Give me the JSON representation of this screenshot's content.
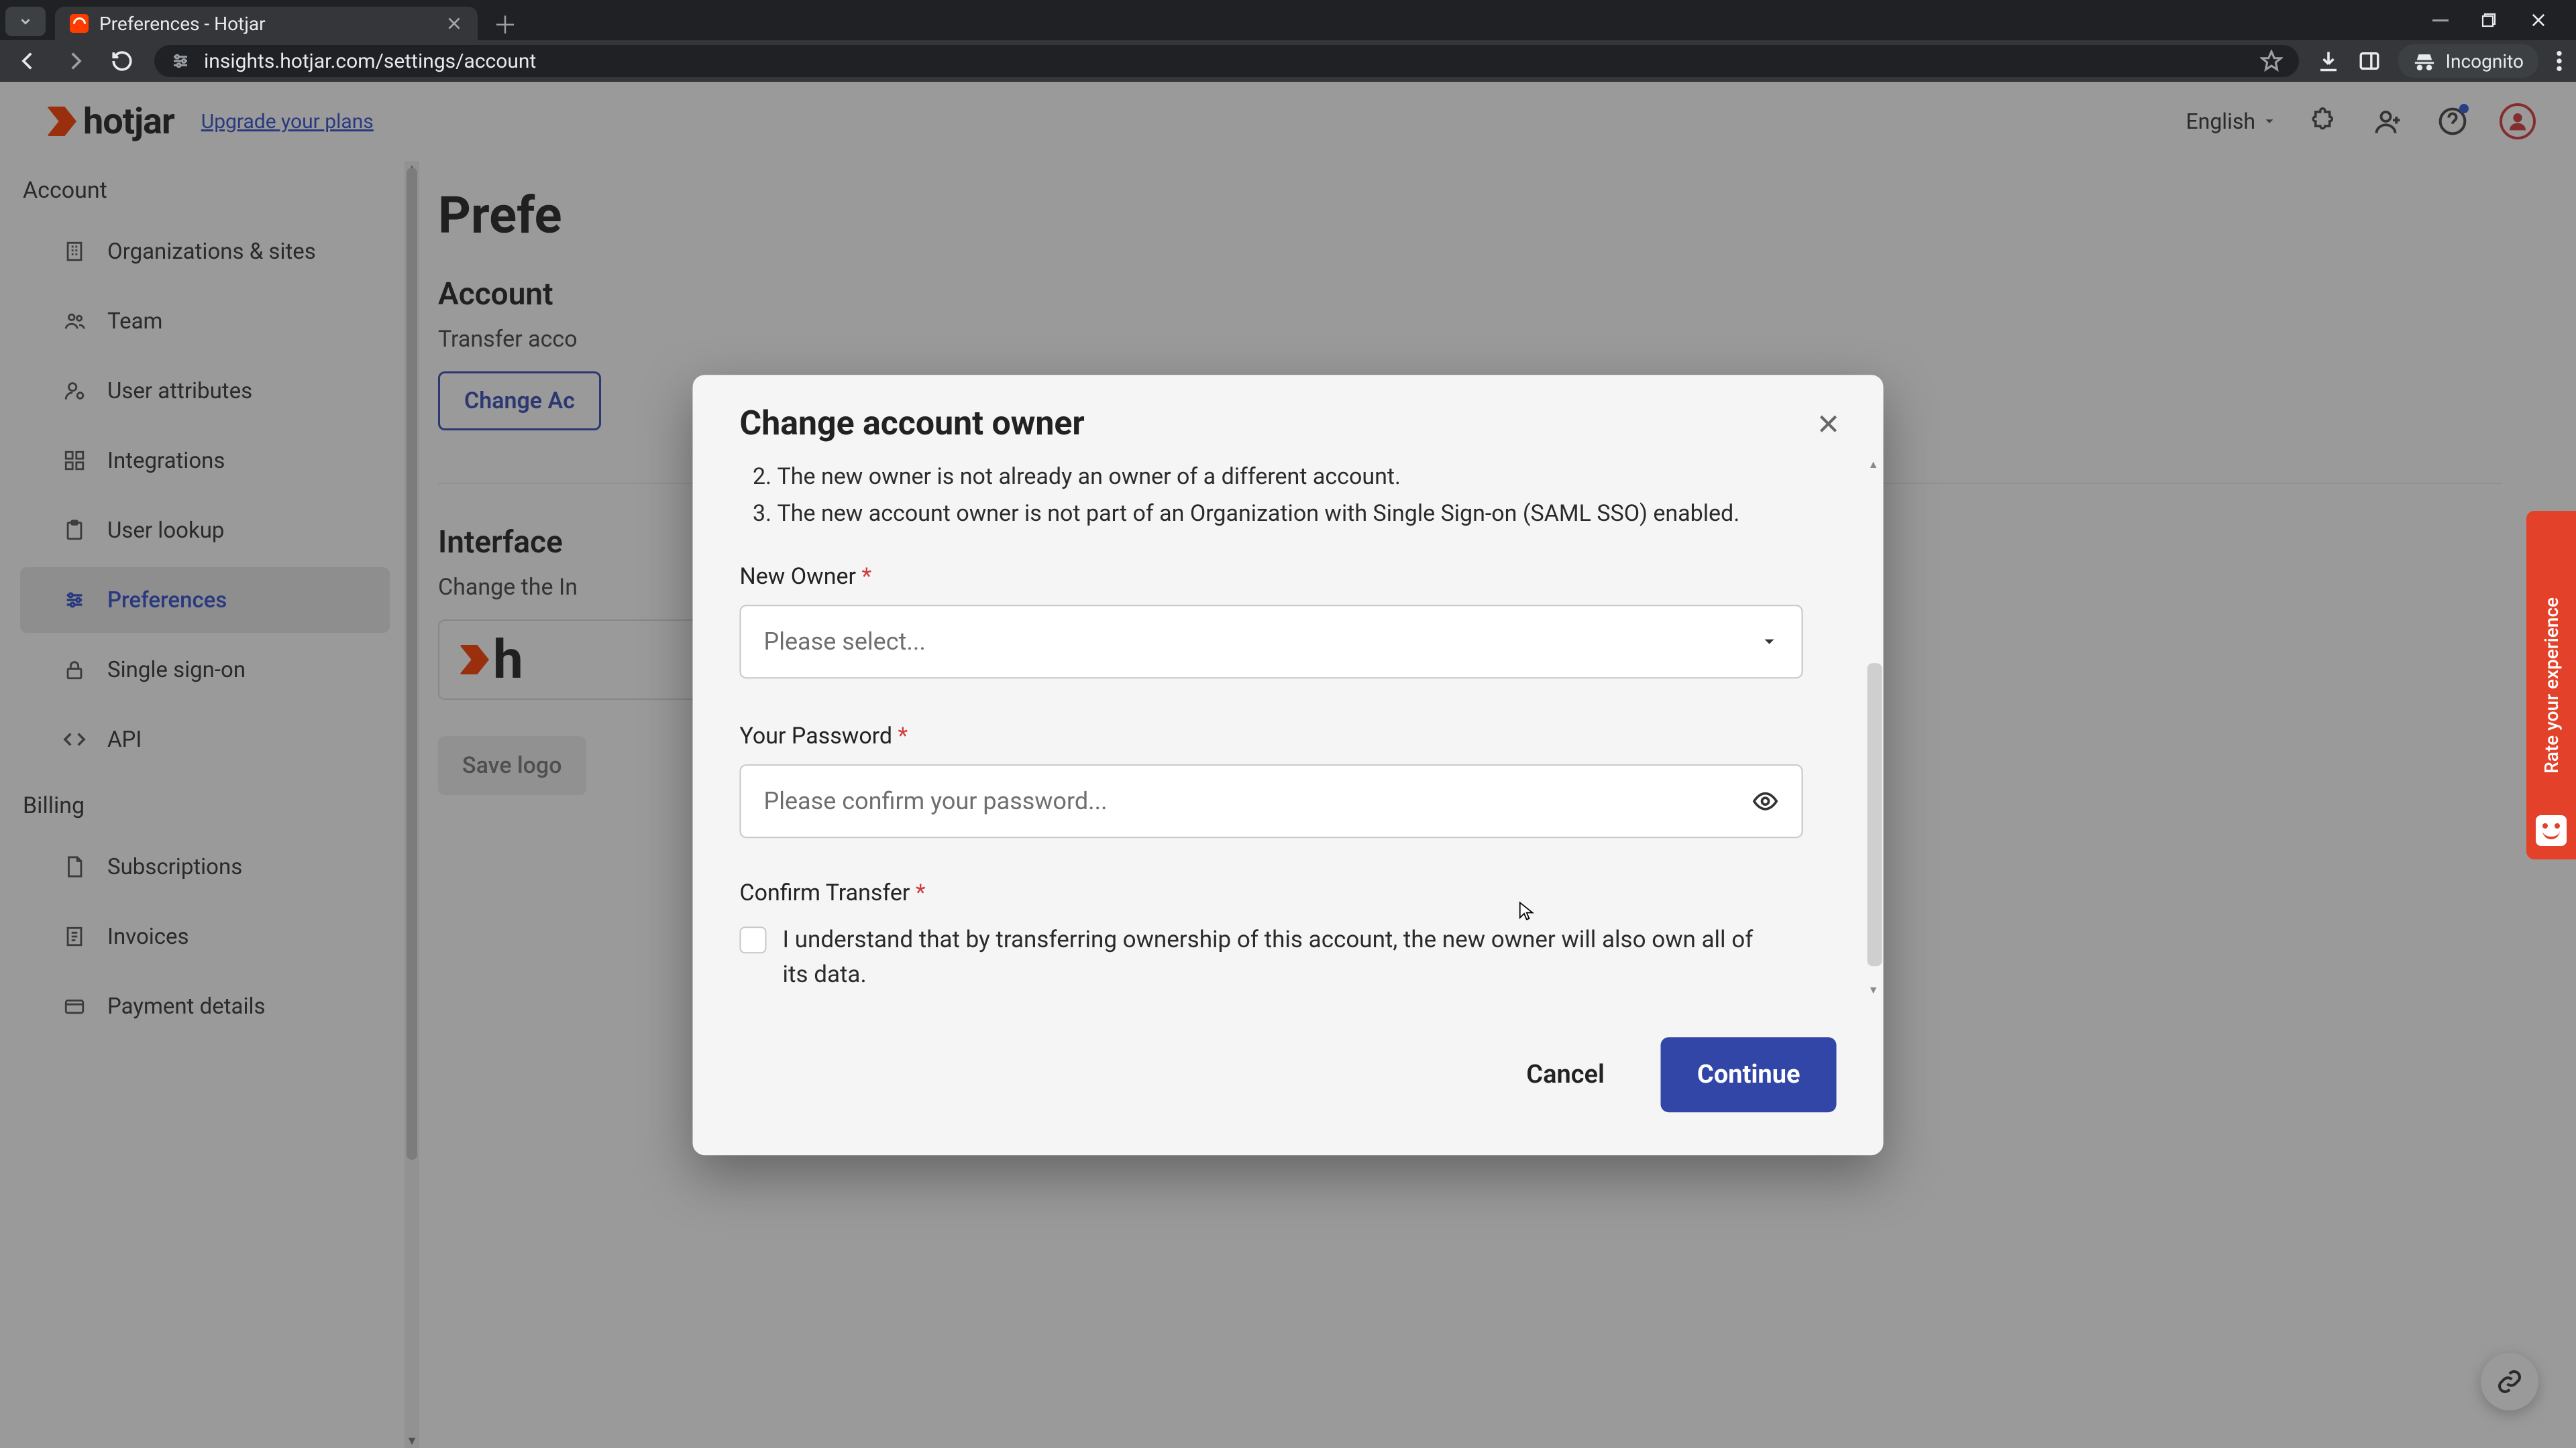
{
  "browser": {
    "tab_title": "Preferences - Hotjar",
    "url": "insights.hotjar.com/settings/account",
    "incognito_label": "Incognito"
  },
  "appbar": {
    "brand": "hotjar",
    "upgrade": "Upgrade your plans",
    "language": "English"
  },
  "sidebar": {
    "section_account": "Account",
    "items_account": [
      "Organizations & sites",
      "Team",
      "User attributes",
      "Integrations",
      "User lookup",
      "Preferences",
      "Single sign-on",
      "API"
    ],
    "section_billing": "Billing",
    "items_billing": [
      "Subscriptions",
      "Invoices",
      "Payment details"
    ]
  },
  "content": {
    "h1": "Prefe",
    "h2_owner": "Account",
    "owner_text_partial": "Transfer acco",
    "change_owner_btn_partial": "Change Ac",
    "h2_interface": "Interface",
    "interface_text_partial": "Change the In",
    "logo_partial": "h",
    "save_logo": "Save logo"
  },
  "feedback": {
    "label": "Rate your experience"
  },
  "modal": {
    "title": "Change account owner",
    "li2": "The new owner is not already an owner of a different account.",
    "li3": "The new account owner is not part of an Organization with Single Sign-on (SAML SSO) enabled.",
    "label_new_owner": "New Owner",
    "select_placeholder": "Please select...",
    "label_password": "Your Password",
    "password_placeholder": "Please confirm your password...",
    "label_confirm": "Confirm Transfer",
    "confirm_text": "I understand that by transferring ownership of this account, the new owner will also own all of its data.",
    "cancel": "Cancel",
    "continue": "Continue"
  }
}
